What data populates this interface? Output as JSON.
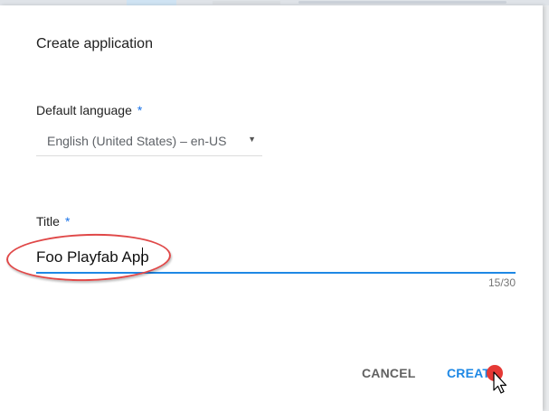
{
  "dialog": {
    "title": "Create application",
    "language_field": {
      "label": "Default language",
      "required_mark": "*",
      "selected": "English (United States) – en-US",
      "arrow_glyph": "▼"
    },
    "title_field": {
      "label": "Title",
      "required_mark": "*",
      "value": "Foo Playfab App",
      "counter": "15/30"
    },
    "buttons": {
      "cancel": "CANCEL",
      "create": "CREATE"
    }
  },
  "colors": {
    "accent": "#1e88e5",
    "highlight": "#e04848",
    "click_dot": "#e53935"
  }
}
